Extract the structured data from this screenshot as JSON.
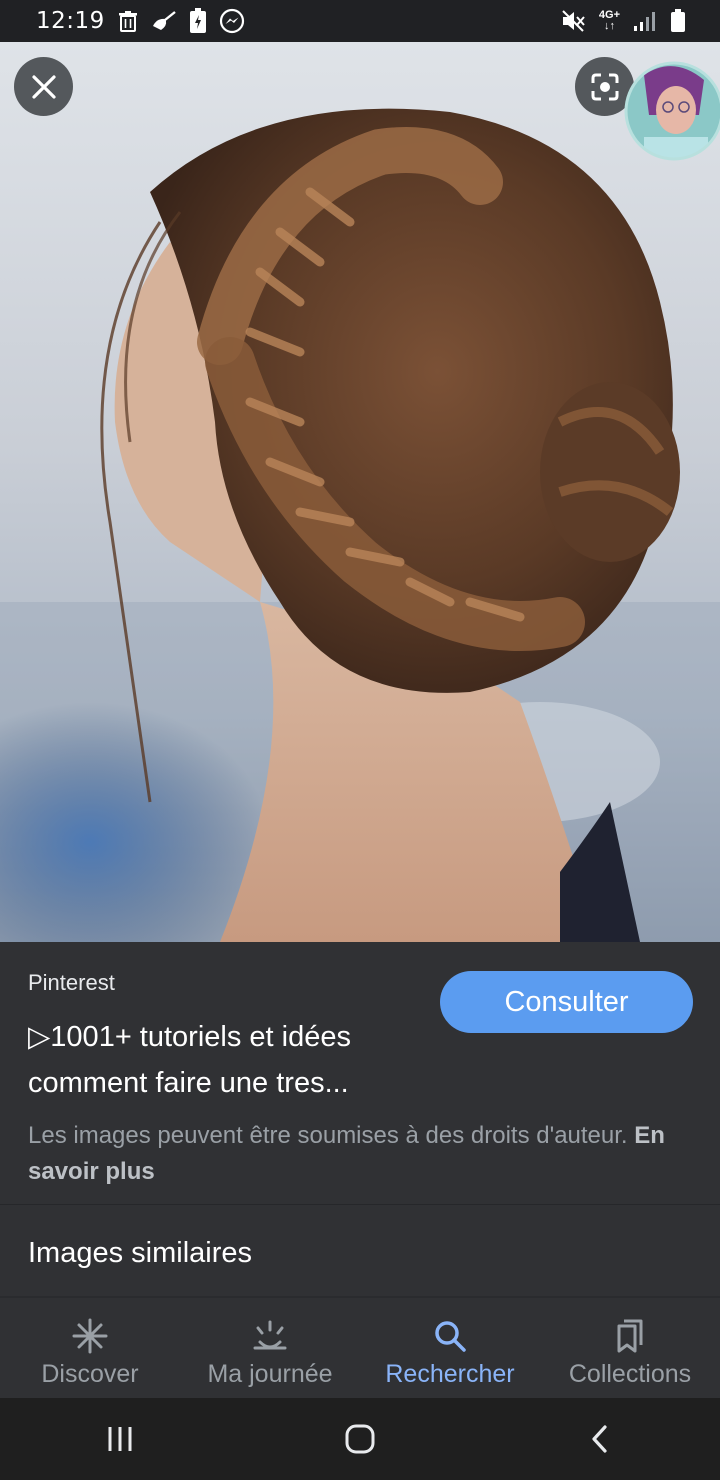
{
  "status_bar": {
    "time": "12:19",
    "network_label": "4G+",
    "icons": [
      "trash-icon",
      "broom-icon",
      "battery-saver-icon",
      "messenger-icon",
      "mute-icon",
      "signal-icon",
      "battery-icon"
    ]
  },
  "viewer": {
    "close_icon": "close-icon",
    "lens_icon": "google-lens-icon",
    "avatar_icon": "profile-avatar"
  },
  "result": {
    "source": "Pinterest",
    "title": "▷1001+ tutoriels et idées comment faire une tres...",
    "consult_label": "Consulter",
    "copyright_text": "Les images peuvent être soumises à des droits d'auteur.",
    "learn_more": "En savoir plus"
  },
  "similar": {
    "title": "Images similaires"
  },
  "bottom_nav": {
    "items": [
      {
        "label": "Discover",
        "icon": "asterisk-icon",
        "active": false
      },
      {
        "label": "Ma journée",
        "icon": "sunrise-icon",
        "active": false
      },
      {
        "label": "Rechercher",
        "icon": "search-icon",
        "active": true
      },
      {
        "label": "Collections",
        "icon": "bookmarks-icon",
        "active": false
      }
    ]
  },
  "system_nav": {
    "icons": [
      "recents-icon",
      "home-icon",
      "back-icon"
    ]
  },
  "colors": {
    "background": "#202124",
    "panel": "#303134",
    "accent": "#8ab4f8",
    "button": "#5b9cf0"
  }
}
